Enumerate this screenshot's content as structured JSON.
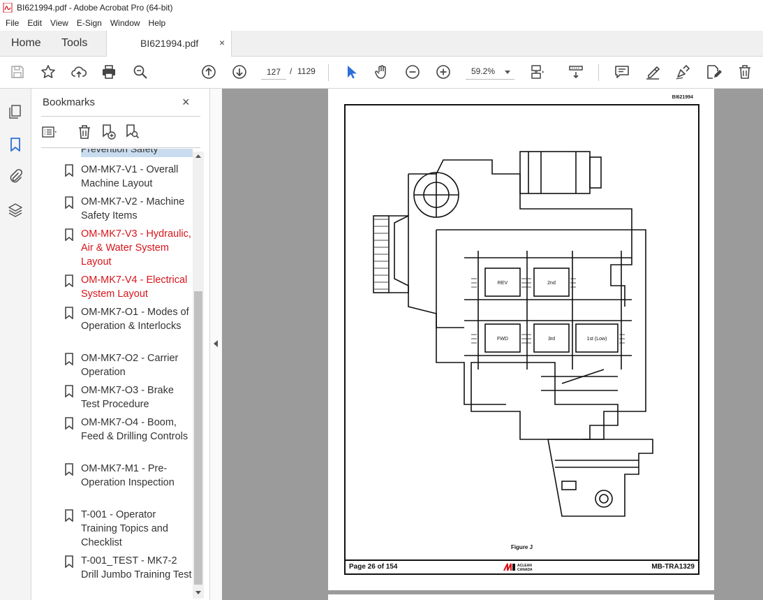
{
  "window": {
    "title": "BI621994.pdf - Adobe Acrobat Pro (64-bit)"
  },
  "menu": {
    "items": [
      "File",
      "Edit",
      "View",
      "E-Sign",
      "Window",
      "Help"
    ]
  },
  "tabs": {
    "home": "Home",
    "tools": "Tools",
    "document": "BI621994.pdf",
    "close_glyph": "×"
  },
  "toolbar": {
    "current_page": "127",
    "page_separator": "/",
    "total_pages": "1129",
    "zoom": "59.2%"
  },
  "bookmarks": {
    "title": "Bookmarks",
    "close_glyph": "×",
    "partial_item": "Prevention Safety",
    "items": [
      {
        "label": "OM-MK7-V1 - Overall Machine Layout",
        "color": "#333333"
      },
      {
        "label": "OM-MK7-V2 - Machine Safety Items",
        "color": "#333333"
      },
      {
        "label": "OM-MK7-V3 - Hydraulic, Air & Water System Layout",
        "color": "#d7141a"
      },
      {
        "label": "OM-MK7-V4 - Electrical System Layout",
        "color": "#d7141a"
      },
      {
        "label": "OM-MK7-O1 - Modes of Operation & Interlocks",
        "color": "#333333"
      },
      {
        "label": "OM-MK7-O2 - Carrier Operation",
        "color": "#333333"
      },
      {
        "label": "OM-MK7-O3 - Brake Test Procedure",
        "color": "#333333"
      },
      {
        "label": "OM-MK7-O4 - Boom, Feed & Drilling Controls",
        "color": "#333333"
      },
      {
        "label": "OM-MK7-M1 - Pre-Operation Inspection",
        "color": "#333333"
      },
      {
        "label": "T-001 - Operator Training Topics and Checklist",
        "color": "#333333"
      },
      {
        "label": "T-001_TEST - MK7-2 Drill Jumbo Training Test",
        "color": "#333333"
      }
    ]
  },
  "document": {
    "doc_id": "BI621994",
    "figure_caption": "Figure J",
    "footer_page": "Page 26 of 154",
    "footer_ref": "MB-TRA1329",
    "logo_text_top": "ACLEAN",
    "logo_text_bottom": "CANADA",
    "gear_labels": [
      "REV",
      "2nd",
      "FWD",
      "3rd",
      "1st (Low)"
    ]
  }
}
